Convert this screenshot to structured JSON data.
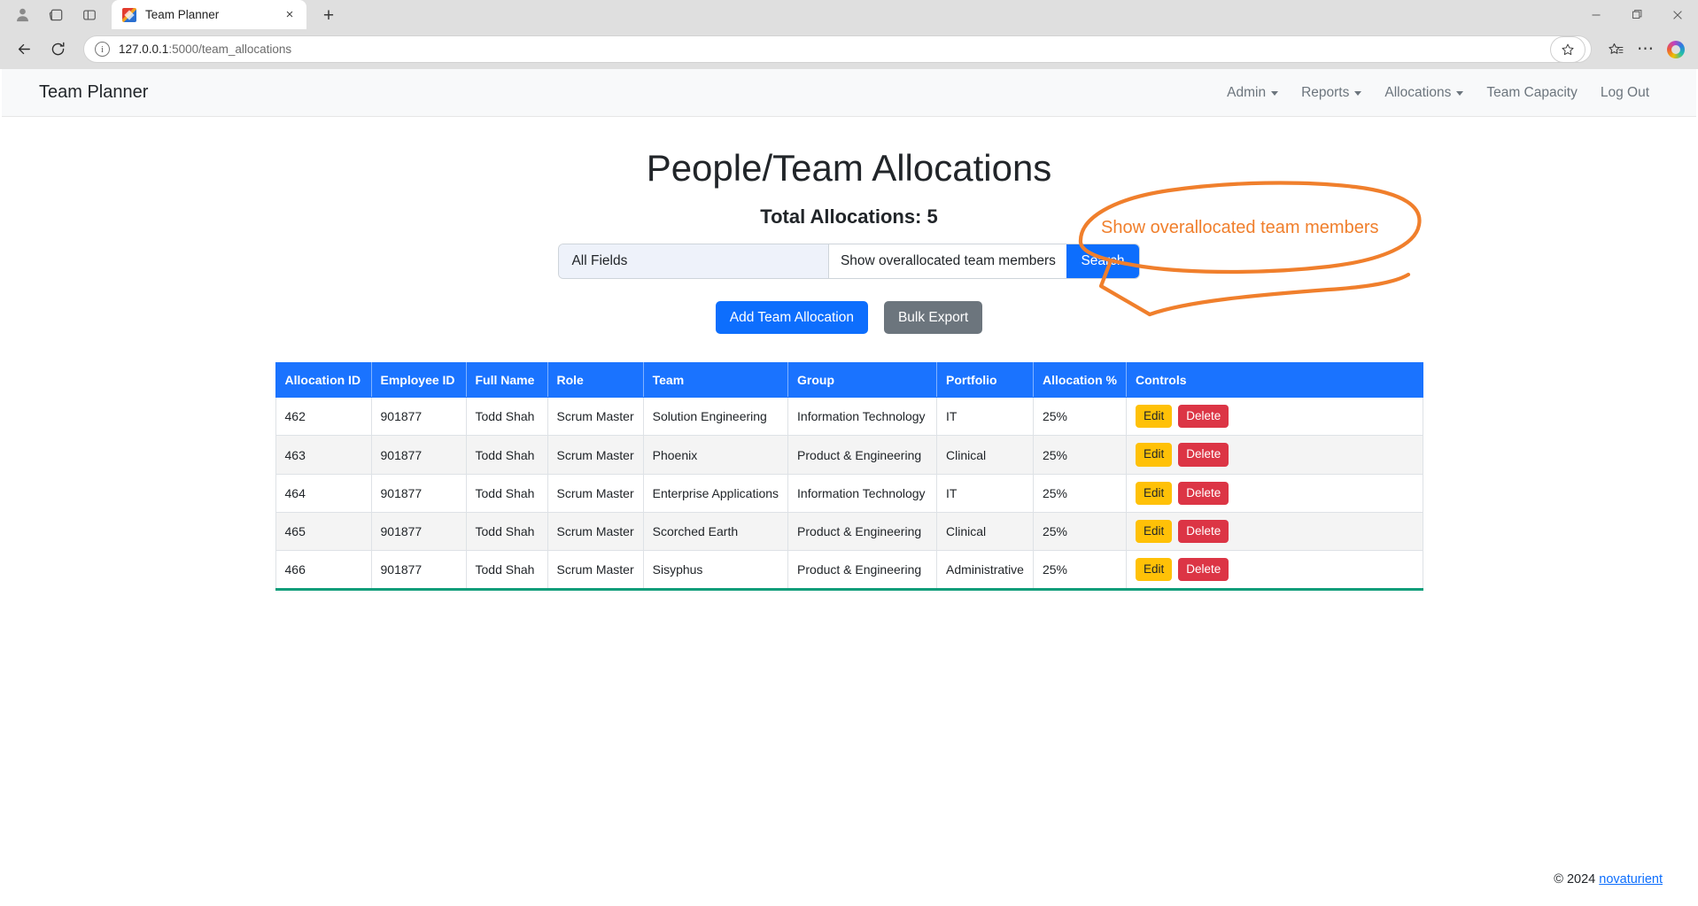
{
  "browser": {
    "tab": {
      "title": "Team Planner",
      "favicon": "app-favicon",
      "close": "×"
    },
    "new_tab": "+",
    "window": {
      "minimize": "—",
      "maximize": "❐",
      "close": "✕"
    },
    "toolbar": {
      "back": "←",
      "reload": "↻",
      "info": "i",
      "url": "127.0.0.1:5000/team_allocations",
      "url_host": "127.0.0.1",
      "url_rest": ":5000/team_allocations",
      "favorite": "☆",
      "collections": "☆",
      "settings_more": "⋯",
      "copilot": "copilot"
    }
  },
  "navbar": {
    "brand": "Team Planner",
    "links": [
      {
        "label": "Admin",
        "dropdown": true
      },
      {
        "label": "Reports",
        "dropdown": true
      },
      {
        "label": "Allocations",
        "dropdown": true
      },
      {
        "label": "Team Capacity",
        "dropdown": false
      },
      {
        "label": "Log Out",
        "dropdown": false
      }
    ]
  },
  "main": {
    "title": "People/Team Allocations",
    "total_label": "Total Allocations: 5",
    "search": {
      "field_select": "All Fields",
      "query_value": "Show overallocated team members",
      "button_label": "Search"
    },
    "actions": {
      "add_label": "Add Team Allocation",
      "export_label": "Bulk Export"
    },
    "table": {
      "columns": [
        "Allocation ID",
        "Employee ID",
        "Full Name",
        "Role",
        "Team",
        "Group",
        "Portfolio",
        "Allocation %",
        "Controls"
      ],
      "rows": [
        {
          "allocation_id": "462",
          "employee_id": "901877",
          "full_name": "Todd Shah",
          "role": "Scrum Master",
          "team": "Solution Engineering",
          "group": "Information Technology",
          "portfolio": "IT",
          "allocation_pct": "25%"
        },
        {
          "allocation_id": "463",
          "employee_id": "901877",
          "full_name": "Todd Shah",
          "role": "Scrum Master",
          "team": "Phoenix",
          "group": "Product & Engineering",
          "portfolio": "Clinical",
          "allocation_pct": "25%"
        },
        {
          "allocation_id": "464",
          "employee_id": "901877",
          "full_name": "Todd Shah",
          "role": "Scrum Master",
          "team": "Enterprise Applications",
          "group": "Information Technology",
          "portfolio": "IT",
          "allocation_pct": "25%"
        },
        {
          "allocation_id": "465",
          "employee_id": "901877",
          "full_name": "Todd Shah",
          "role": "Scrum Master",
          "team": "Scorched Earth",
          "group": "Product & Engineering",
          "portfolio": "Clinical",
          "allocation_pct": "25%"
        },
        {
          "allocation_id": "466",
          "employee_id": "901877",
          "full_name": "Todd Shah",
          "role": "Scrum Master",
          "team": "Sisyphus",
          "group": "Product & Engineering",
          "portfolio": "Administrative",
          "allocation_pct": "25%"
        }
      ],
      "edit_label": "Edit",
      "delete_label": "Delete"
    }
  },
  "annotation": {
    "text": "Show overallocated team members",
    "color": "#f07f2c"
  },
  "footer": {
    "copyright": "© 2024",
    "link_label": "novaturient"
  },
  "colors": {
    "primary": "#0d6efd",
    "table_header": "#1a73ff",
    "edit": "#ffc107",
    "delete": "#dc3545",
    "secondary": "#6c757d",
    "table_underline": "#0f9d7a",
    "annotation": "#f07f2c"
  }
}
